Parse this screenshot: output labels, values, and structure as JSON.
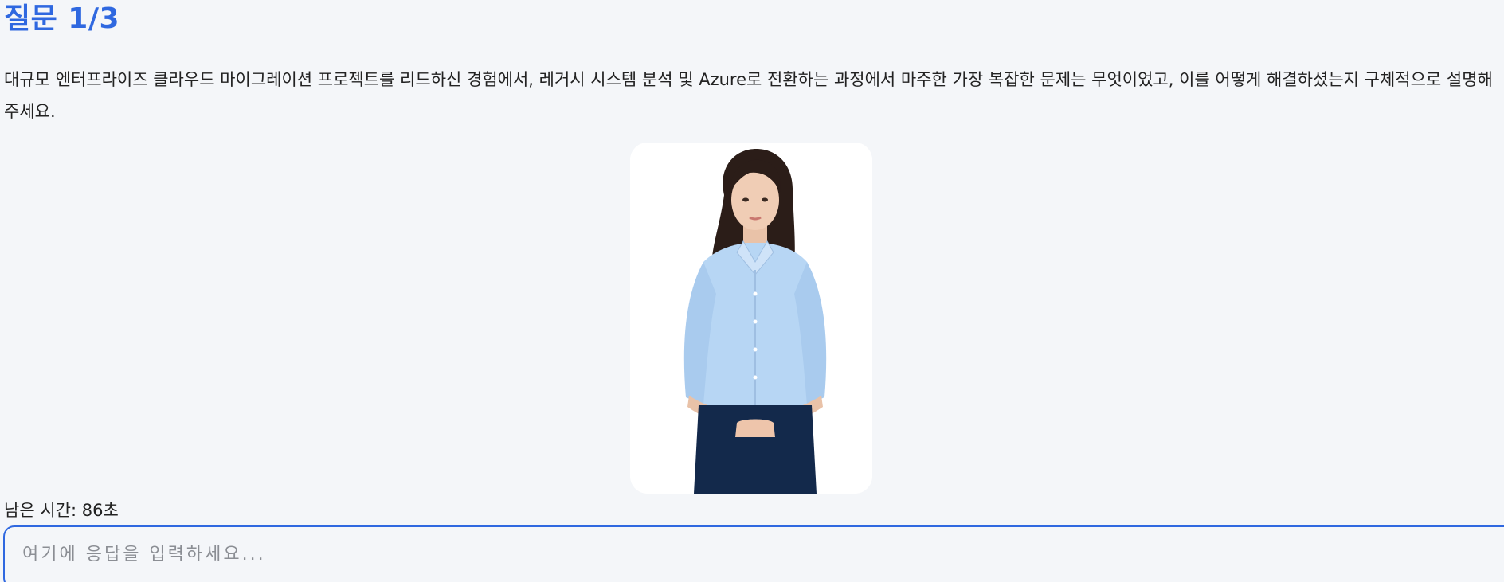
{
  "question": {
    "title": "질문 1/3",
    "text": "대규모 엔터프라이즈 클라우드 마이그레이션 프로젝트를 리드하신 경험에서, 레거시 시스템 분석 및 Azure로 전환하는 과정에서 마주한 가장 복잡한 문제는 무엇이었고, 이를 어떻게 해결하셨는지 구체적으로 설명해 주세요."
  },
  "avatar": {
    "icon": "interviewer-avatar-image",
    "shirt_color": "#b7d6f4",
    "pants_color": "#13294b",
    "hair_color": "#2b1d18"
  },
  "timer": {
    "label": "남은 시간:",
    "value": "86초"
  },
  "answer": {
    "placeholder": "여기에 응답을 입력하세요...",
    "value": ""
  },
  "colors": {
    "accent": "#2f68e0",
    "background": "#f4f6f9"
  }
}
